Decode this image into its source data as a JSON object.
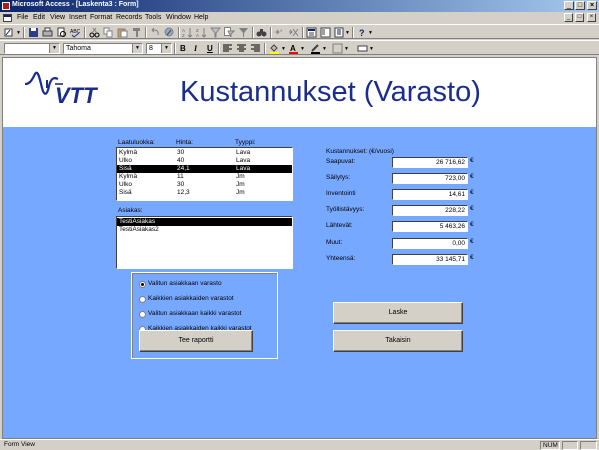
{
  "window": {
    "title": "Microsoft Access - [Laskenta3 : Form]",
    "controls": [
      "_",
      "□",
      "×"
    ]
  },
  "menubar": {
    "items": [
      "File",
      "Edit",
      "View",
      "Insert",
      "Format",
      "Records",
      "Tools",
      "Window",
      "Help"
    ],
    "mdi_controls": [
      "_",
      "□",
      "×"
    ]
  },
  "toolbar": {
    "font_name": "Tahoma",
    "font_size": "8",
    "bold": "B",
    "italic": "I",
    "underline": "U"
  },
  "form": {
    "logo_text": "VTT",
    "title": "Kustannukset (Varasto)",
    "product_list": {
      "headers": [
        "Laatuluokka:",
        "Hinta:",
        "Tyyppi:"
      ],
      "rows": [
        [
          "Kylmä",
          "30",
          "Lava"
        ],
        [
          "Ulko",
          "40",
          "Lava"
        ],
        [
          "Sisä",
          "24,1",
          "Lava"
        ],
        [
          "Kylmä",
          "11",
          "Jm"
        ],
        [
          "Ulko",
          "30",
          "Jm"
        ],
        [
          "Sisä",
          "12,3",
          "Jm"
        ]
      ],
      "selected_row": 2
    },
    "customer_list": {
      "label": "Asiakas:",
      "rows": [
        "TestiAsiakas",
        "TestiAsiakas2"
      ],
      "selected_row": 0
    },
    "costs": {
      "header": "Kustannukset: (€/vuosi)",
      "unit": "€",
      "fields": [
        {
          "label": "Saapuvat:",
          "value": "26 716,62"
        },
        {
          "label": "Säilytys:",
          "value": "723,00"
        },
        {
          "label": "Inventointi",
          "value": "14,61"
        },
        {
          "label": "Työllistävyys:",
          "value": "228,22"
        },
        {
          "label": "Lähtevät:",
          "value": "5 463,26"
        },
        {
          "label": "Muut:",
          "value": "0,00"
        },
        {
          "label": "Yhteensä:",
          "value": "33 145,71"
        }
      ]
    },
    "options": [
      {
        "label": "Valitun asiakkaan varasto",
        "selected": true
      },
      {
        "label": "Kaikkien asiakkaiden varastot",
        "selected": false
      },
      {
        "label": "Valitun asiakkaan kaikki varastot",
        "selected": false
      },
      {
        "label": "Kaikkien asiakkaiden kaikki varastot",
        "selected": false
      }
    ],
    "buttons": {
      "report": "Tee raportti",
      "calculate": "Laske",
      "back": "Takaisin"
    }
  },
  "statusbar": {
    "text": "Form View",
    "num": "NUM"
  },
  "colors": {
    "detail_background": "#77a8ff",
    "title_color": "#1a2d8f",
    "titlebar_start": "#0a246a",
    "titlebar_end": "#a6caf0",
    "logo_color": "#1a2d8f"
  }
}
